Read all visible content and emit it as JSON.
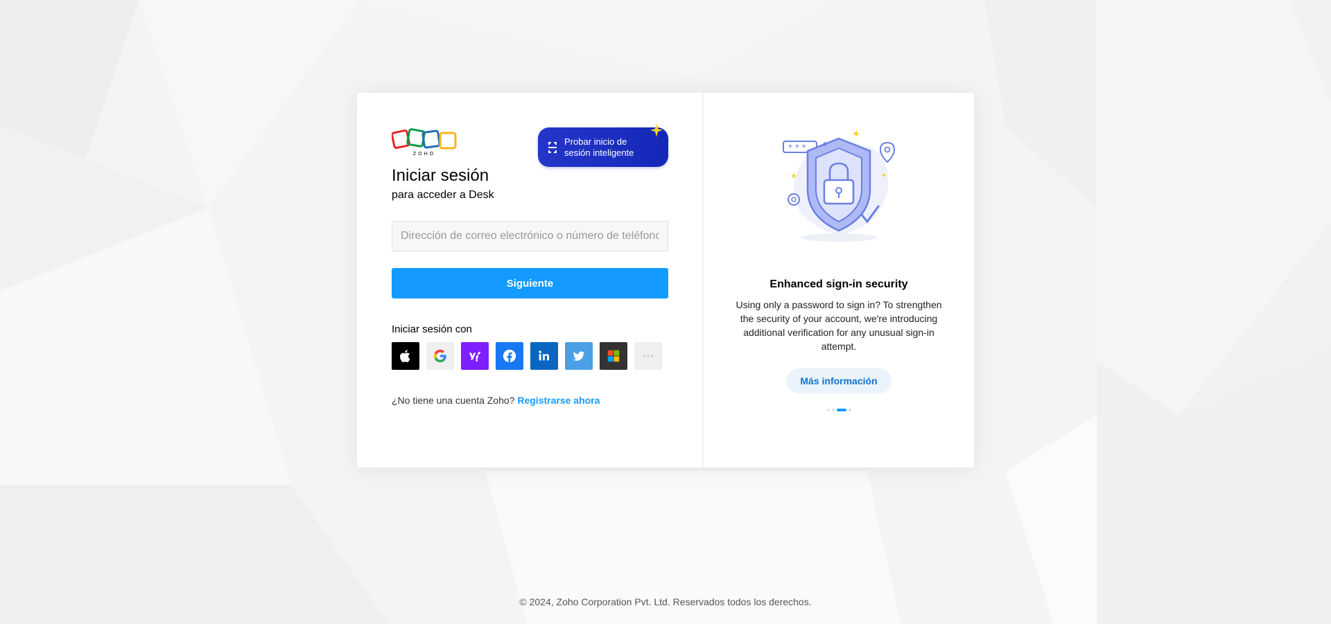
{
  "colors": {
    "primary": "#159aff",
    "smart_button": "#1428b8",
    "background": "#f4f4f4"
  },
  "brand": {
    "logo_text": "ZOHO"
  },
  "smart_signin": {
    "label": "Probar inicio de sesión inteligente"
  },
  "signin": {
    "title": "Iniciar sesión",
    "subtitle": "para acceder a Desk",
    "email_placeholder": "Dirección de correo electrónico o número de teléfono",
    "next_label": "Siguiente",
    "signin_with_label": "Iniciar sesión con",
    "identity_providers": [
      {
        "name": "apple",
        "icon": "apple-icon",
        "bg": "#000000"
      },
      {
        "name": "google",
        "icon": "google-icon",
        "bg": "#efefef"
      },
      {
        "name": "yahoo",
        "icon": "yahoo-icon",
        "bg": "#7e1fff"
      },
      {
        "name": "facebook",
        "icon": "facebook-icon",
        "bg": "#1877f2"
      },
      {
        "name": "linkedin",
        "icon": "linkedin-icon",
        "bg": "#0a66c2"
      },
      {
        "name": "twitter",
        "icon": "twitter-icon",
        "bg": "#4a9fe6"
      },
      {
        "name": "microsoft",
        "icon": "microsoft-icon",
        "bg": "#333333"
      },
      {
        "name": "more",
        "icon": "more-icon",
        "bg": "#efefef"
      }
    ],
    "no_account_text": "¿No tiene una cuenta Zoho?",
    "signup_link": "Registrarse ahora"
  },
  "promo": {
    "title": "Enhanced sign-in security",
    "description": "Using only a password to sign in? To strengthen the security of your account, we're introducing additional verification for any unusual sign-in attempt.",
    "button_label": "Más información",
    "active_slide": 3,
    "slide_count": 4
  },
  "footer": {
    "copyright": "© 2024, Zoho Corporation Pvt. Ltd. Reservados todos los derechos."
  }
}
